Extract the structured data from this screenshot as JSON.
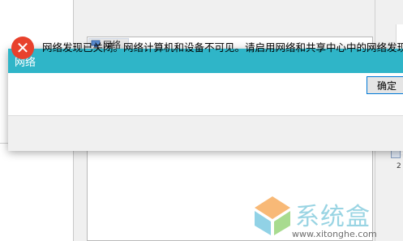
{
  "background": {
    "tree_item_label": "网络",
    "right_text": "2"
  },
  "dialog": {
    "title": "网络",
    "message": "网络发现已关闭。网络计算机和设备不可见。请启用网络和共享中心中的网络发现。",
    "ok_label": "确定",
    "error_symbol": "✕"
  },
  "watermark": {
    "brand": "系统盒",
    "url": "www.xitonghe.com"
  },
  "colors": {
    "titlebar": "#2fb5c8",
    "error": "#e8412c",
    "button_border": "#0078d7"
  }
}
